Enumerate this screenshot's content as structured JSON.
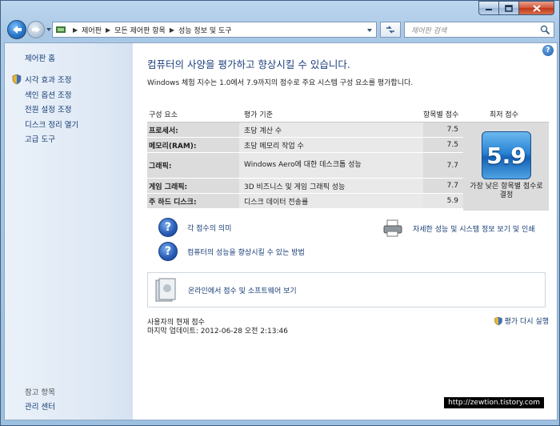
{
  "window": {
    "address": [
      "제어판",
      "모든 제어판 항목",
      "성능 정보 및 도구"
    ],
    "search_placeholder": "제어판 검색"
  },
  "sidebar": {
    "home": "제어판 홈",
    "items": [
      {
        "label": "시각 효과 조정",
        "icon": "shield-icon"
      },
      {
        "label": "색인 옵션 조정"
      },
      {
        "label": "전원 설정 조정"
      },
      {
        "label": "디스크 정리 열기"
      },
      {
        "label": "고급 도구"
      }
    ],
    "see_also_title": "참고 항목",
    "see_also_items": [
      "관리 센터"
    ]
  },
  "main": {
    "heading": "컴퓨터의 사양을 평가하고 향상시킬 수 있습니다.",
    "description": "Windows 체험 지수는 1.0에서 7.9까지의 점수로 주요 시스템 구성 요소를 평가합니다.",
    "table": {
      "headers": {
        "component": "구성 요소",
        "criteria": "평가 기준",
        "subscore": "항목별 점수",
        "base": "최저 점수"
      },
      "rows": [
        {
          "component": "프로세서:",
          "criteria": "초당 계산 수",
          "score": "7.5"
        },
        {
          "component": "메모리(RAM):",
          "criteria": "초당 메모리 작업 수",
          "score": "7.5"
        },
        {
          "component": "그래픽:",
          "criteria": "Windows Aero에 대한 데스크톱 성능",
          "score": "7.7"
        },
        {
          "component": "게임 그래픽:",
          "criteria": "3D 비즈니스 및 게임 그래픽 성능",
          "score": "7.7"
        },
        {
          "component": "주 하드 디스크:",
          "criteria": "디스크 데이터 전송률",
          "score": "5.9"
        }
      ],
      "base_score": "5.9",
      "base_caption": "가장 낮은 항목별 점수로 결정"
    },
    "links": {
      "meaning": "각 점수의 의미",
      "improve": "컴퓨터의 성능을 향상시킬 수 있는 방법",
      "details": "자세한 성능 및 시스템 정보 보기 및 인쇄",
      "online": "온라인에서 점수 및 소프트웨어 보기"
    },
    "status": {
      "current": "사용자의 현재 점수",
      "last_update": "마지막 업데이트: 2012-06-28 오전 2:13:46",
      "rerun": "평가 다시 실행"
    },
    "help_label": "?"
  },
  "watermark": "http://zewtion.tistory.com",
  "colors": {
    "link": "#153b74",
    "heading": "#1c3f7c",
    "badge": "#2a84d4"
  }
}
